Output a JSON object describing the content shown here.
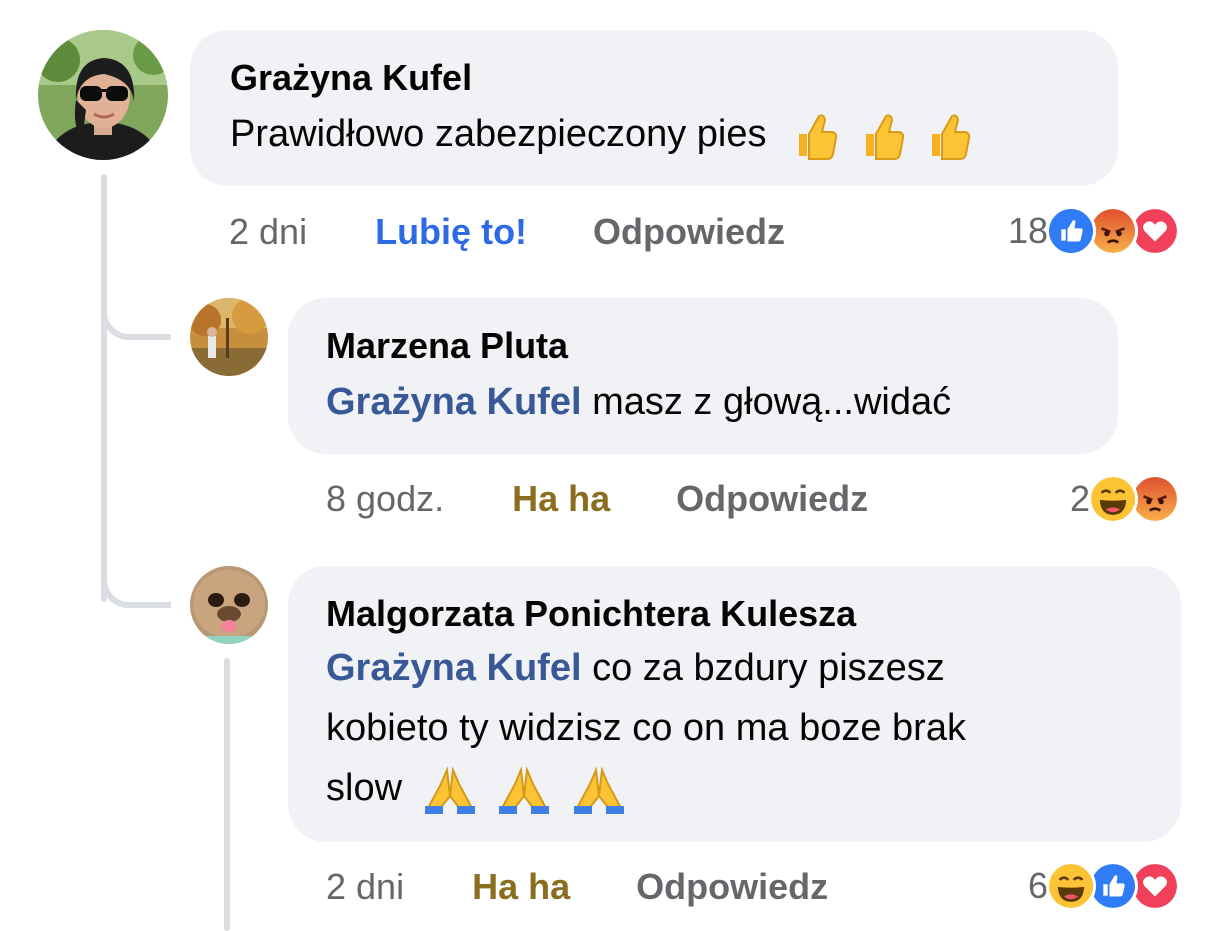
{
  "comments": [
    {
      "author": "Grażyna Kufel",
      "text": "Prawidłowo zabezpieczony pies",
      "emoji": [
        "thumbs-up",
        "thumbs-up",
        "thumbs-up"
      ],
      "time": "2 dni",
      "reaction_label": "Lubię to!",
      "reaction_color": "#2d6ae3",
      "reply_label": "Odpowiedz",
      "reaction_count": "18",
      "reactions": [
        "like",
        "angry",
        "love"
      ]
    },
    {
      "author": "Marzena Pluta",
      "mention": "Grażyna Kufel",
      "text": " masz z głową...widać",
      "time": "8 godz.",
      "reaction_label": "Ha ha",
      "reaction_color": "#8a6d1e",
      "reply_label": "Odpowiedz",
      "reaction_count": "2",
      "reactions": [
        "haha",
        "angry"
      ]
    },
    {
      "author": "Malgorzata Ponichtera Kulesza",
      "mention": "Grażyna Kufel",
      "text_line1": " co za bzdury piszesz",
      "text_line2": "kobieto ty widzisz co on ma boze brak",
      "text_line3": "slow",
      "emoji": [
        "folded-hands",
        "folded-hands",
        "folded-hands"
      ],
      "time": "2 dni",
      "reaction_label": "Ha ha",
      "reaction_color": "#8a6d1e",
      "reply_label": "Odpowiedz",
      "reaction_count": "6",
      "reactions": [
        "haha",
        "like",
        "love"
      ]
    }
  ]
}
